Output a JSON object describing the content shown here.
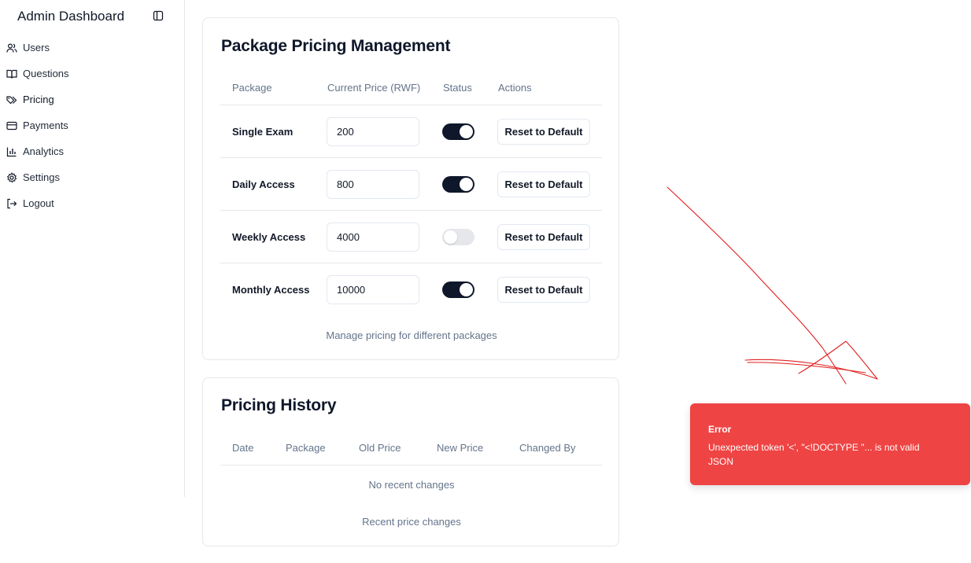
{
  "sidebar": {
    "title": "Admin Dashboard",
    "toggle_icon": "sidebar-toggle-icon",
    "items": [
      {
        "label": "Users",
        "icon": "users-icon"
      },
      {
        "label": "Questions",
        "icon": "book-open-icon"
      },
      {
        "label": "Pricing",
        "icon": "tags-icon",
        "active": true
      },
      {
        "label": "Payments",
        "icon": "credit-card-icon"
      },
      {
        "label": "Analytics",
        "icon": "bar-chart-icon"
      },
      {
        "label": "Settings",
        "icon": "gear-icon"
      },
      {
        "label": "Logout",
        "icon": "logout-icon"
      }
    ]
  },
  "pricing": {
    "title": "Package Pricing Management",
    "headers": {
      "package": "Package",
      "price": "Current Price (RWF)",
      "status": "Status",
      "actions": "Actions"
    },
    "rows": [
      {
        "name": "Single Exam",
        "price": "200",
        "enabled": true,
        "action": "Reset to Default"
      },
      {
        "name": "Daily Access",
        "price": "800",
        "enabled": true,
        "action": "Reset to Default"
      },
      {
        "name": "Weekly Access",
        "price": "4000",
        "enabled": false,
        "action": "Reset to Default"
      },
      {
        "name": "Monthly Access",
        "price": "10000",
        "enabled": true,
        "action": "Reset to Default"
      }
    ],
    "caption": "Manage pricing for different packages"
  },
  "history": {
    "title": "Pricing History",
    "headers": {
      "date": "Date",
      "package": "Package",
      "old_price": "Old Price",
      "new_price": "New Price",
      "changed_by": "Changed By"
    },
    "empty": "No recent changes",
    "caption": "Recent price changes"
  },
  "toast": {
    "title": "Error",
    "message": "Unexpected token '<', \"<!DOCTYPE \"... is not valid JSON"
  },
  "colors": {
    "toast_bg": "#ef4444",
    "switch_on": "#0f172a",
    "switch_off": "#e5e7eb",
    "annotation": "#e11d1d"
  }
}
